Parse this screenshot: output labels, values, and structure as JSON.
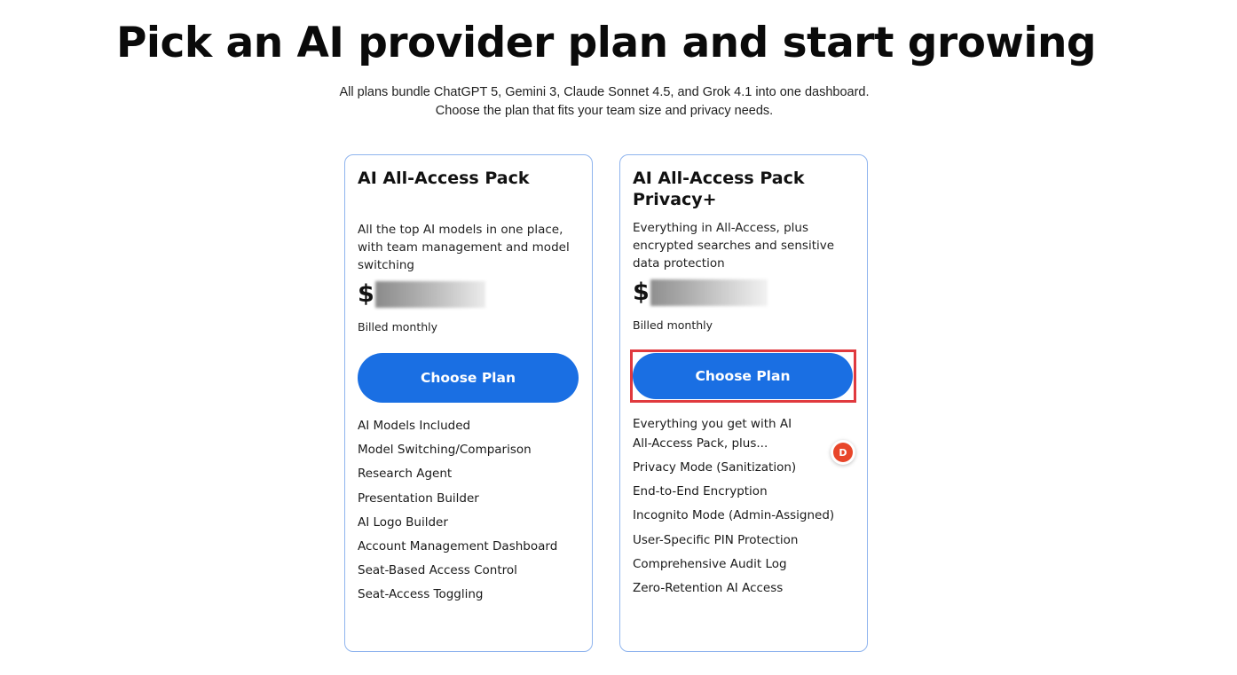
{
  "header": {
    "title": "Pick an AI provider plan and start growing",
    "subtitle_line1": "All plans bundle ChatGPT 5, Gemini 3, Claude Sonnet 4.5, and Grok 4.1 into one dashboard.",
    "subtitle_line2": "Choose the plan that fits your team size and privacy needs."
  },
  "plans": [
    {
      "title": "AI All-Access Pack",
      "description": "All the top AI models in one place, with team management and model switching",
      "currency": "$",
      "price_hidden": true,
      "billing": "Billed monthly",
      "button_label": "Choose Plan",
      "features": [
        "AI Models Included",
        "Model Switching/Comparison",
        "Research Agent",
        "Presentation Builder",
        "AI Logo Builder",
        "Account Management Dashboard",
        "Seat-Based Access Control",
        "Seat-Access Toggling"
      ]
    },
    {
      "title": "AI All-Access Pack Privacy+",
      "description": "Everything in All-Access, plus encrypted searches and sensitive data protection",
      "currency": "$",
      "price_hidden": true,
      "billing": "Billed monthly",
      "button_label": "Choose Plan",
      "button_highlighted": true,
      "features_intro": "Everything you get with AI All-Access Pack, plus...",
      "features": [
        "Privacy Mode (Sanitization)",
        "End-to-End Encryption",
        "Incognito Mode (Admin-Assigned)",
        "User-Specific PIN Protection",
        "Comprehensive Audit Log",
        "Zero-Retention AI Access"
      ]
    }
  ],
  "avatar": {
    "initial": "D",
    "color": "#e8462a"
  },
  "colors": {
    "accent": "#1a6fe3",
    "card_border": "#8fb4ee",
    "highlight": "#e0393e"
  }
}
